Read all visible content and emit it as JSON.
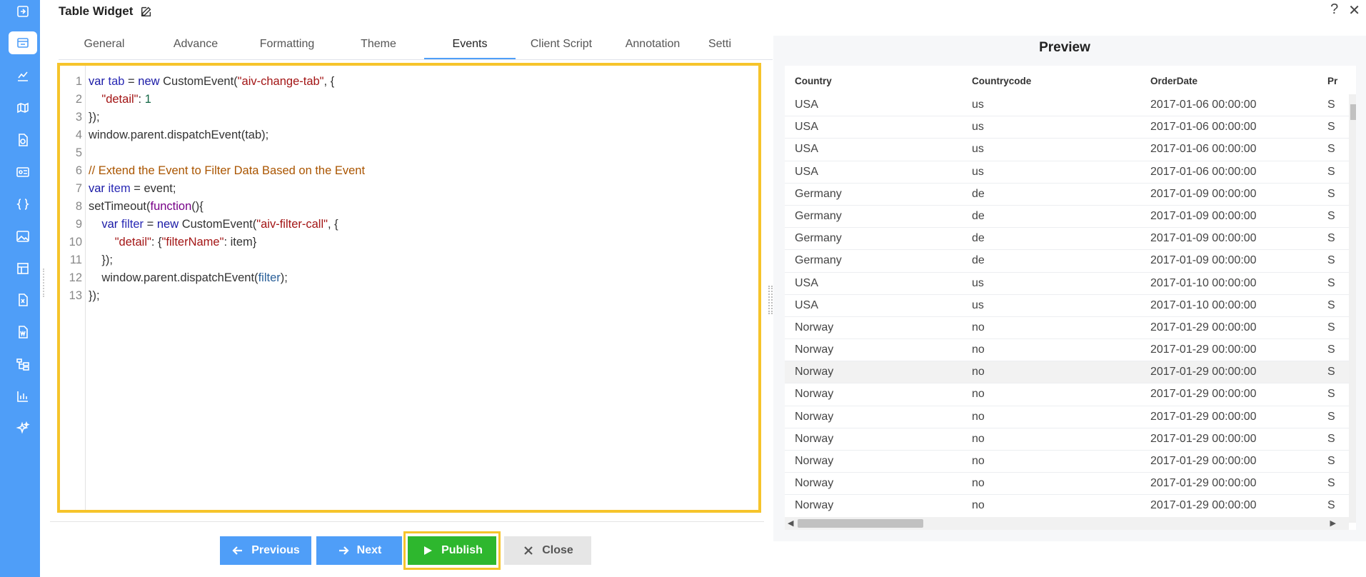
{
  "window": {
    "title": "Table Widget",
    "help_label": "?",
    "close_label": "✕"
  },
  "tabs": [
    {
      "label": "General"
    },
    {
      "label": "Advance"
    },
    {
      "label": "Formatting"
    },
    {
      "label": "Theme"
    },
    {
      "label": "Events",
      "active": true
    },
    {
      "label": "Client Script"
    },
    {
      "label": "Annotation"
    },
    {
      "label": "Setti"
    }
  ],
  "editor": {
    "line_numbers": [
      "1",
      "2",
      "3",
      "4",
      "5",
      "6",
      "7",
      "8",
      "9",
      "10",
      "11",
      "12",
      "13"
    ]
  },
  "buttons": {
    "previous": "Previous",
    "next": "Next",
    "publish": "Publish",
    "close": "Close"
  },
  "preview": {
    "title": "Preview",
    "columns": [
      "Country",
      "Countrycode",
      "OrderDate",
      "Pr"
    ],
    "rows": [
      [
        "USA",
        "us",
        "2017-01-06 00:00:00",
        "S"
      ],
      [
        "USA",
        "us",
        "2017-01-06 00:00:00",
        "S"
      ],
      [
        "USA",
        "us",
        "2017-01-06 00:00:00",
        "S"
      ],
      [
        "USA",
        "us",
        "2017-01-06 00:00:00",
        "S"
      ],
      [
        "Germany",
        "de",
        "2017-01-09 00:00:00",
        "S"
      ],
      [
        "Germany",
        "de",
        "2017-01-09 00:00:00",
        "S"
      ],
      [
        "Germany",
        "de",
        "2017-01-09 00:00:00",
        "S"
      ],
      [
        "Germany",
        "de",
        "2017-01-09 00:00:00",
        "S"
      ],
      [
        "USA",
        "us",
        "2017-01-10 00:00:00",
        "S"
      ],
      [
        "USA",
        "us",
        "2017-01-10 00:00:00",
        "S"
      ],
      [
        "Norway",
        "no",
        "2017-01-29 00:00:00",
        "S"
      ],
      [
        "Norway",
        "no",
        "2017-01-29 00:00:00",
        "S"
      ],
      [
        "Norway",
        "no",
        "2017-01-29 00:00:00",
        "S"
      ],
      [
        "Norway",
        "no",
        "2017-01-29 00:00:00",
        "S"
      ],
      [
        "Norway",
        "no",
        "2017-01-29 00:00:00",
        "S"
      ],
      [
        "Norway",
        "no",
        "2017-01-29 00:00:00",
        "S"
      ],
      [
        "Norway",
        "no",
        "2017-01-29 00:00:00",
        "S"
      ],
      [
        "Norway",
        "no",
        "2017-01-29 00:00:00",
        "S"
      ],
      [
        "Norway",
        "no",
        "2017-01-29 00:00:00",
        "S"
      ]
    ]
  },
  "sidebar": {
    "icons": [
      "arrow-right-box-icon",
      "table-icon",
      "line-chart-icon",
      "map-icon",
      "report-icon",
      "id-card-icon",
      "braces-icon",
      "image-icon",
      "layout-icon",
      "excel-icon",
      "word-icon",
      "tree-icon",
      "bar-chart-icon",
      "sparkle-icon"
    ]
  }
}
